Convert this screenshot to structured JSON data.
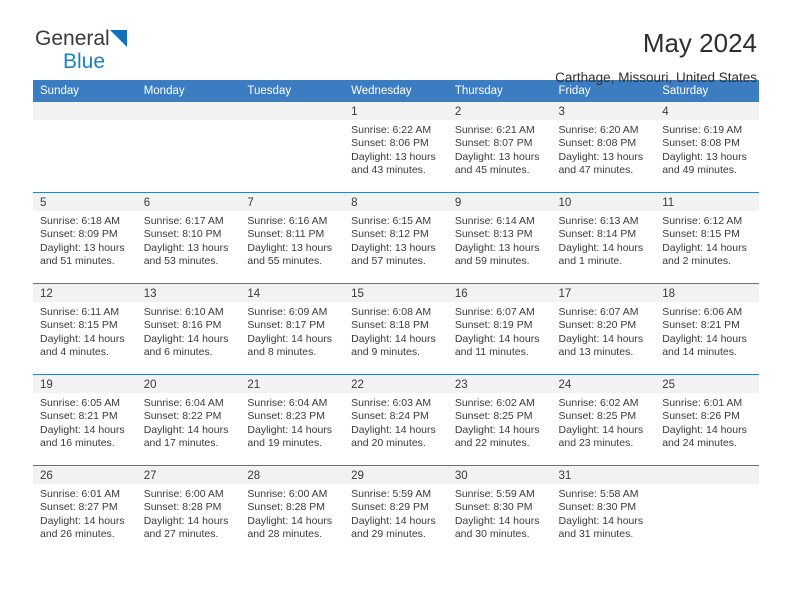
{
  "brand": {
    "name_part1": "General",
    "name_part2": "Blue",
    "triangle_icon": "triangle-icon",
    "accent_color": "#1f7fc4"
  },
  "header": {
    "month_title": "May 2024",
    "location": "Carthage, Missouri, United States"
  },
  "theme": {
    "header_bar_color": "#3b7dc0",
    "daynum_band_color": "#f2f2f2",
    "text_color": "#3a3a3a"
  },
  "calendar": {
    "weekday_headers": [
      "Sunday",
      "Monday",
      "Tuesday",
      "Wednesday",
      "Thursday",
      "Friday",
      "Saturday"
    ],
    "weeks": [
      [
        {
          "day": "",
          "sunrise": "",
          "sunset": "",
          "daylight_line1": "",
          "daylight_line2": ""
        },
        {
          "day": "",
          "sunrise": "",
          "sunset": "",
          "daylight_line1": "",
          "daylight_line2": ""
        },
        {
          "day": "",
          "sunrise": "",
          "sunset": "",
          "daylight_line1": "",
          "daylight_line2": ""
        },
        {
          "day": "1",
          "sunrise": "Sunrise: 6:22 AM",
          "sunset": "Sunset: 8:06 PM",
          "daylight_line1": "Daylight: 13 hours",
          "daylight_line2": "and 43 minutes."
        },
        {
          "day": "2",
          "sunrise": "Sunrise: 6:21 AM",
          "sunset": "Sunset: 8:07 PM",
          "daylight_line1": "Daylight: 13 hours",
          "daylight_line2": "and 45 minutes."
        },
        {
          "day": "3",
          "sunrise": "Sunrise: 6:20 AM",
          "sunset": "Sunset: 8:08 PM",
          "daylight_line1": "Daylight: 13 hours",
          "daylight_line2": "and 47 minutes."
        },
        {
          "day": "4",
          "sunrise": "Sunrise: 6:19 AM",
          "sunset": "Sunset: 8:08 PM",
          "daylight_line1": "Daylight: 13 hours",
          "daylight_line2": "and 49 minutes."
        }
      ],
      [
        {
          "day": "5",
          "sunrise": "Sunrise: 6:18 AM",
          "sunset": "Sunset: 8:09 PM",
          "daylight_line1": "Daylight: 13 hours",
          "daylight_line2": "and 51 minutes."
        },
        {
          "day": "6",
          "sunrise": "Sunrise: 6:17 AM",
          "sunset": "Sunset: 8:10 PM",
          "daylight_line1": "Daylight: 13 hours",
          "daylight_line2": "and 53 minutes."
        },
        {
          "day": "7",
          "sunrise": "Sunrise: 6:16 AM",
          "sunset": "Sunset: 8:11 PM",
          "daylight_line1": "Daylight: 13 hours",
          "daylight_line2": "and 55 minutes."
        },
        {
          "day": "8",
          "sunrise": "Sunrise: 6:15 AM",
          "sunset": "Sunset: 8:12 PM",
          "daylight_line1": "Daylight: 13 hours",
          "daylight_line2": "and 57 minutes."
        },
        {
          "day": "9",
          "sunrise": "Sunrise: 6:14 AM",
          "sunset": "Sunset: 8:13 PM",
          "daylight_line1": "Daylight: 13 hours",
          "daylight_line2": "and 59 minutes."
        },
        {
          "day": "10",
          "sunrise": "Sunrise: 6:13 AM",
          "sunset": "Sunset: 8:14 PM",
          "daylight_line1": "Daylight: 14 hours",
          "daylight_line2": "and 1 minute."
        },
        {
          "day": "11",
          "sunrise": "Sunrise: 6:12 AM",
          "sunset": "Sunset: 8:15 PM",
          "daylight_line1": "Daylight: 14 hours",
          "daylight_line2": "and 2 minutes."
        }
      ],
      [
        {
          "day": "12",
          "sunrise": "Sunrise: 6:11 AM",
          "sunset": "Sunset: 8:15 PM",
          "daylight_line1": "Daylight: 14 hours",
          "daylight_line2": "and 4 minutes."
        },
        {
          "day": "13",
          "sunrise": "Sunrise: 6:10 AM",
          "sunset": "Sunset: 8:16 PM",
          "daylight_line1": "Daylight: 14 hours",
          "daylight_line2": "and 6 minutes."
        },
        {
          "day": "14",
          "sunrise": "Sunrise: 6:09 AM",
          "sunset": "Sunset: 8:17 PM",
          "daylight_line1": "Daylight: 14 hours",
          "daylight_line2": "and 8 minutes."
        },
        {
          "day": "15",
          "sunrise": "Sunrise: 6:08 AM",
          "sunset": "Sunset: 8:18 PM",
          "daylight_line1": "Daylight: 14 hours",
          "daylight_line2": "and 9 minutes."
        },
        {
          "day": "16",
          "sunrise": "Sunrise: 6:07 AM",
          "sunset": "Sunset: 8:19 PM",
          "daylight_line1": "Daylight: 14 hours",
          "daylight_line2": "and 11 minutes."
        },
        {
          "day": "17",
          "sunrise": "Sunrise: 6:07 AM",
          "sunset": "Sunset: 8:20 PM",
          "daylight_line1": "Daylight: 14 hours",
          "daylight_line2": "and 13 minutes."
        },
        {
          "day": "18",
          "sunrise": "Sunrise: 6:06 AM",
          "sunset": "Sunset: 8:21 PM",
          "daylight_line1": "Daylight: 14 hours",
          "daylight_line2": "and 14 minutes."
        }
      ],
      [
        {
          "day": "19",
          "sunrise": "Sunrise: 6:05 AM",
          "sunset": "Sunset: 8:21 PM",
          "daylight_line1": "Daylight: 14 hours",
          "daylight_line2": "and 16 minutes."
        },
        {
          "day": "20",
          "sunrise": "Sunrise: 6:04 AM",
          "sunset": "Sunset: 8:22 PM",
          "daylight_line1": "Daylight: 14 hours",
          "daylight_line2": "and 17 minutes."
        },
        {
          "day": "21",
          "sunrise": "Sunrise: 6:04 AM",
          "sunset": "Sunset: 8:23 PM",
          "daylight_line1": "Daylight: 14 hours",
          "daylight_line2": "and 19 minutes."
        },
        {
          "day": "22",
          "sunrise": "Sunrise: 6:03 AM",
          "sunset": "Sunset: 8:24 PM",
          "daylight_line1": "Daylight: 14 hours",
          "daylight_line2": "and 20 minutes."
        },
        {
          "day": "23",
          "sunrise": "Sunrise: 6:02 AM",
          "sunset": "Sunset: 8:25 PM",
          "daylight_line1": "Daylight: 14 hours",
          "daylight_line2": "and 22 minutes."
        },
        {
          "day": "24",
          "sunrise": "Sunrise: 6:02 AM",
          "sunset": "Sunset: 8:25 PM",
          "daylight_line1": "Daylight: 14 hours",
          "daylight_line2": "and 23 minutes."
        },
        {
          "day": "25",
          "sunrise": "Sunrise: 6:01 AM",
          "sunset": "Sunset: 8:26 PM",
          "daylight_line1": "Daylight: 14 hours",
          "daylight_line2": "and 24 minutes."
        }
      ],
      [
        {
          "day": "26",
          "sunrise": "Sunrise: 6:01 AM",
          "sunset": "Sunset: 8:27 PM",
          "daylight_line1": "Daylight: 14 hours",
          "daylight_line2": "and 26 minutes."
        },
        {
          "day": "27",
          "sunrise": "Sunrise: 6:00 AM",
          "sunset": "Sunset: 8:28 PM",
          "daylight_line1": "Daylight: 14 hours",
          "daylight_line2": "and 27 minutes."
        },
        {
          "day": "28",
          "sunrise": "Sunrise: 6:00 AM",
          "sunset": "Sunset: 8:28 PM",
          "daylight_line1": "Daylight: 14 hours",
          "daylight_line2": "and 28 minutes."
        },
        {
          "day": "29",
          "sunrise": "Sunrise: 5:59 AM",
          "sunset": "Sunset: 8:29 PM",
          "daylight_line1": "Daylight: 14 hours",
          "daylight_line2": "and 29 minutes."
        },
        {
          "day": "30",
          "sunrise": "Sunrise: 5:59 AM",
          "sunset": "Sunset: 8:30 PM",
          "daylight_line1": "Daylight: 14 hours",
          "daylight_line2": "and 30 minutes."
        },
        {
          "day": "31",
          "sunrise": "Sunrise: 5:58 AM",
          "sunset": "Sunset: 8:30 PM",
          "daylight_line1": "Daylight: 14 hours",
          "daylight_line2": "and 31 minutes."
        },
        {
          "day": "",
          "sunrise": "",
          "sunset": "",
          "daylight_line1": "",
          "daylight_line2": ""
        }
      ]
    ]
  }
}
